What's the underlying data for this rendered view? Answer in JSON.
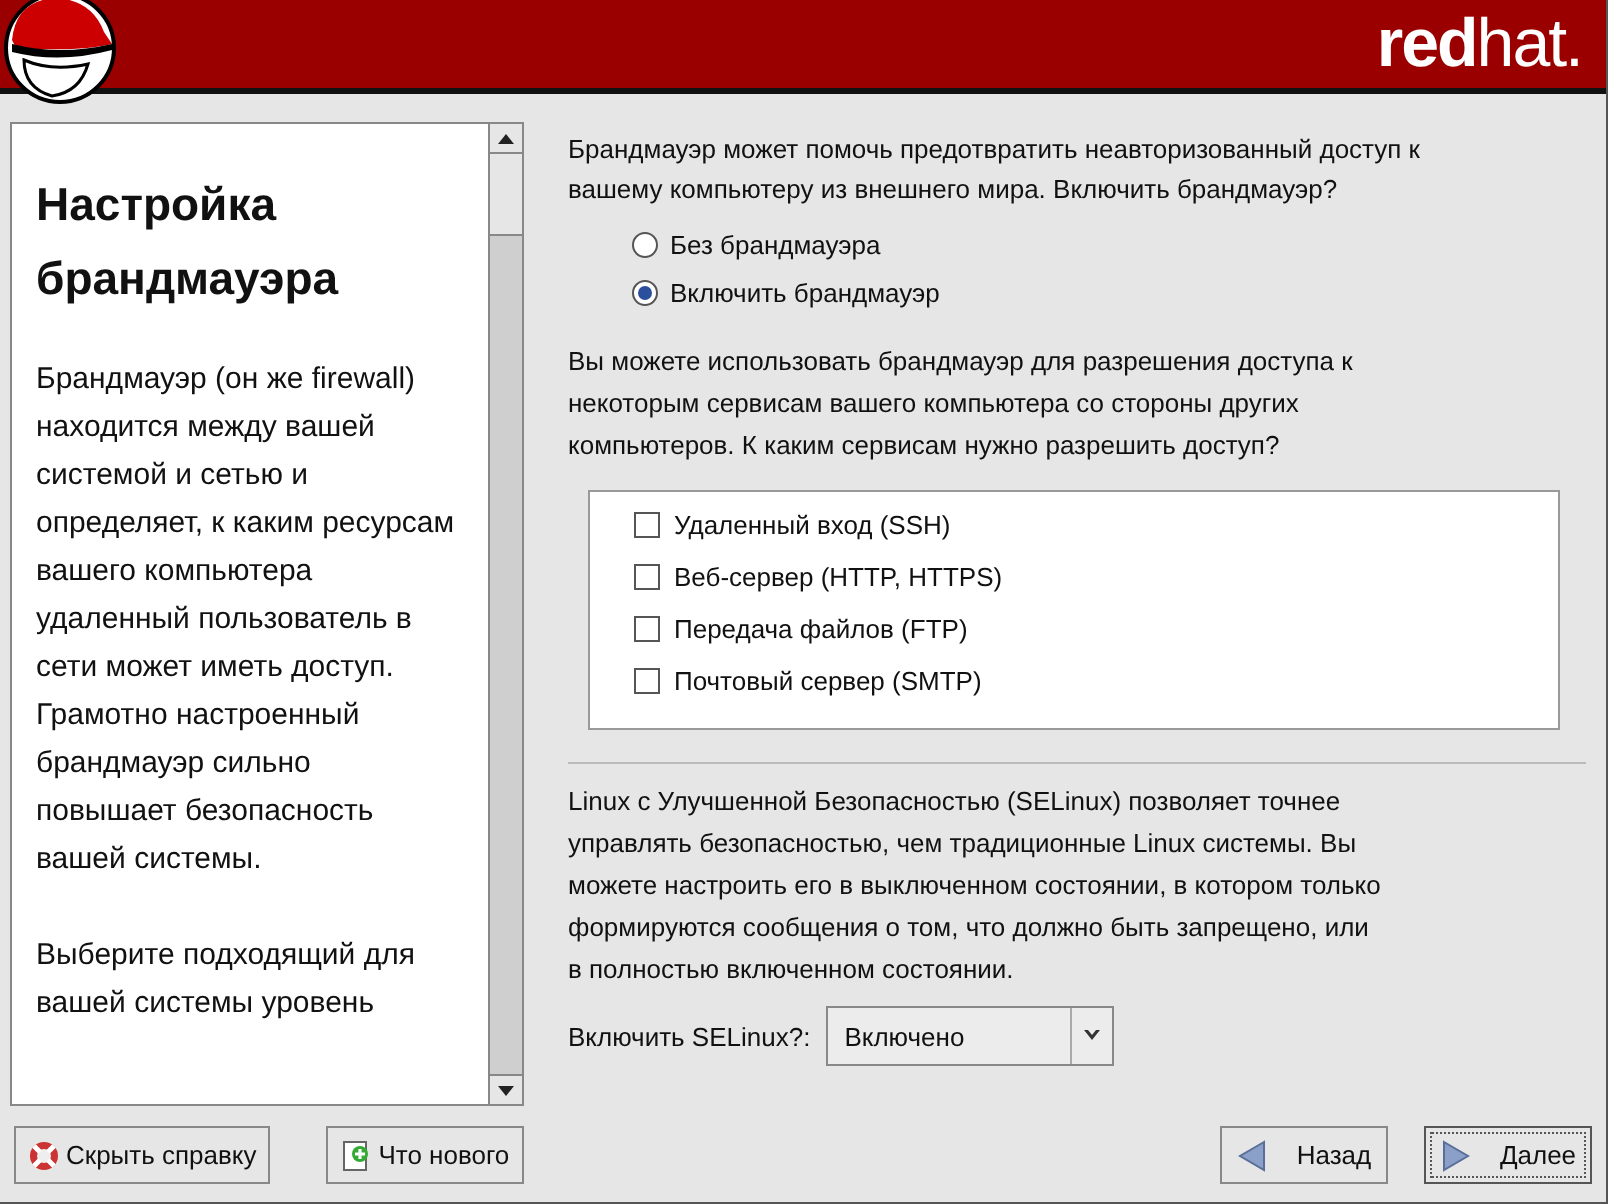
{
  "header": {
    "logo_text_1": "red",
    "logo_text_2": "hat."
  },
  "help": {
    "title": "Настройка брандмауэра",
    "paragraphs": [
      "Брандмауэр (он же firewall) находится между вашей системой и сетью и определяет, к каким ресурсам вашего компьютера удаленный пользователь в сети может иметь доступ. Грамотно настроенный брандмауэр сильно повышает безопасность вашей системы.",
      "Выберите подходящий для вашей системы уровень"
    ]
  },
  "firewall": {
    "intro": "Брандмауэр может помочь предотвратить неавторизованный доступ к вашему компьютеру из внешнего мира. Включить брандмауэр?",
    "options": [
      {
        "label": "Без брандмауэра",
        "selected": false
      },
      {
        "label": "Включить брандмауэр",
        "selected": true
      }
    ],
    "services_intro": "Вы можете использовать брандмауэр для разрешения доступа к некоторым сервисам вашего компьютера со стороны других компьютеров. К каким сервисам нужно разрешить доступ?",
    "services": [
      {
        "label": "Удаленный вход (SSH)",
        "checked": false
      },
      {
        "label": "Веб-сервер (HTTP, HTTPS)",
        "checked": false
      },
      {
        "label": "Передача файлов (FTP)",
        "checked": false
      },
      {
        "label": "Почтовый сервер (SMTP)",
        "checked": false
      }
    ]
  },
  "selinux": {
    "text": "Linux с Улучшенной Безопасностью (SELinux) позволяет точнее управлять безопасностью, чем традиционные Linux системы. Вы можете настроить его в выключенном состоянии, в котором только формируются сообщения о том, что должно быть запрещено, или в полностью включенном состоянии.",
    "label": "Включить SELinux?:",
    "value": "Включено"
  },
  "buttons": {
    "hide_help": "Скрыть справку",
    "whats_new": "Что нового",
    "back": "Назад",
    "next": "Далее"
  }
}
